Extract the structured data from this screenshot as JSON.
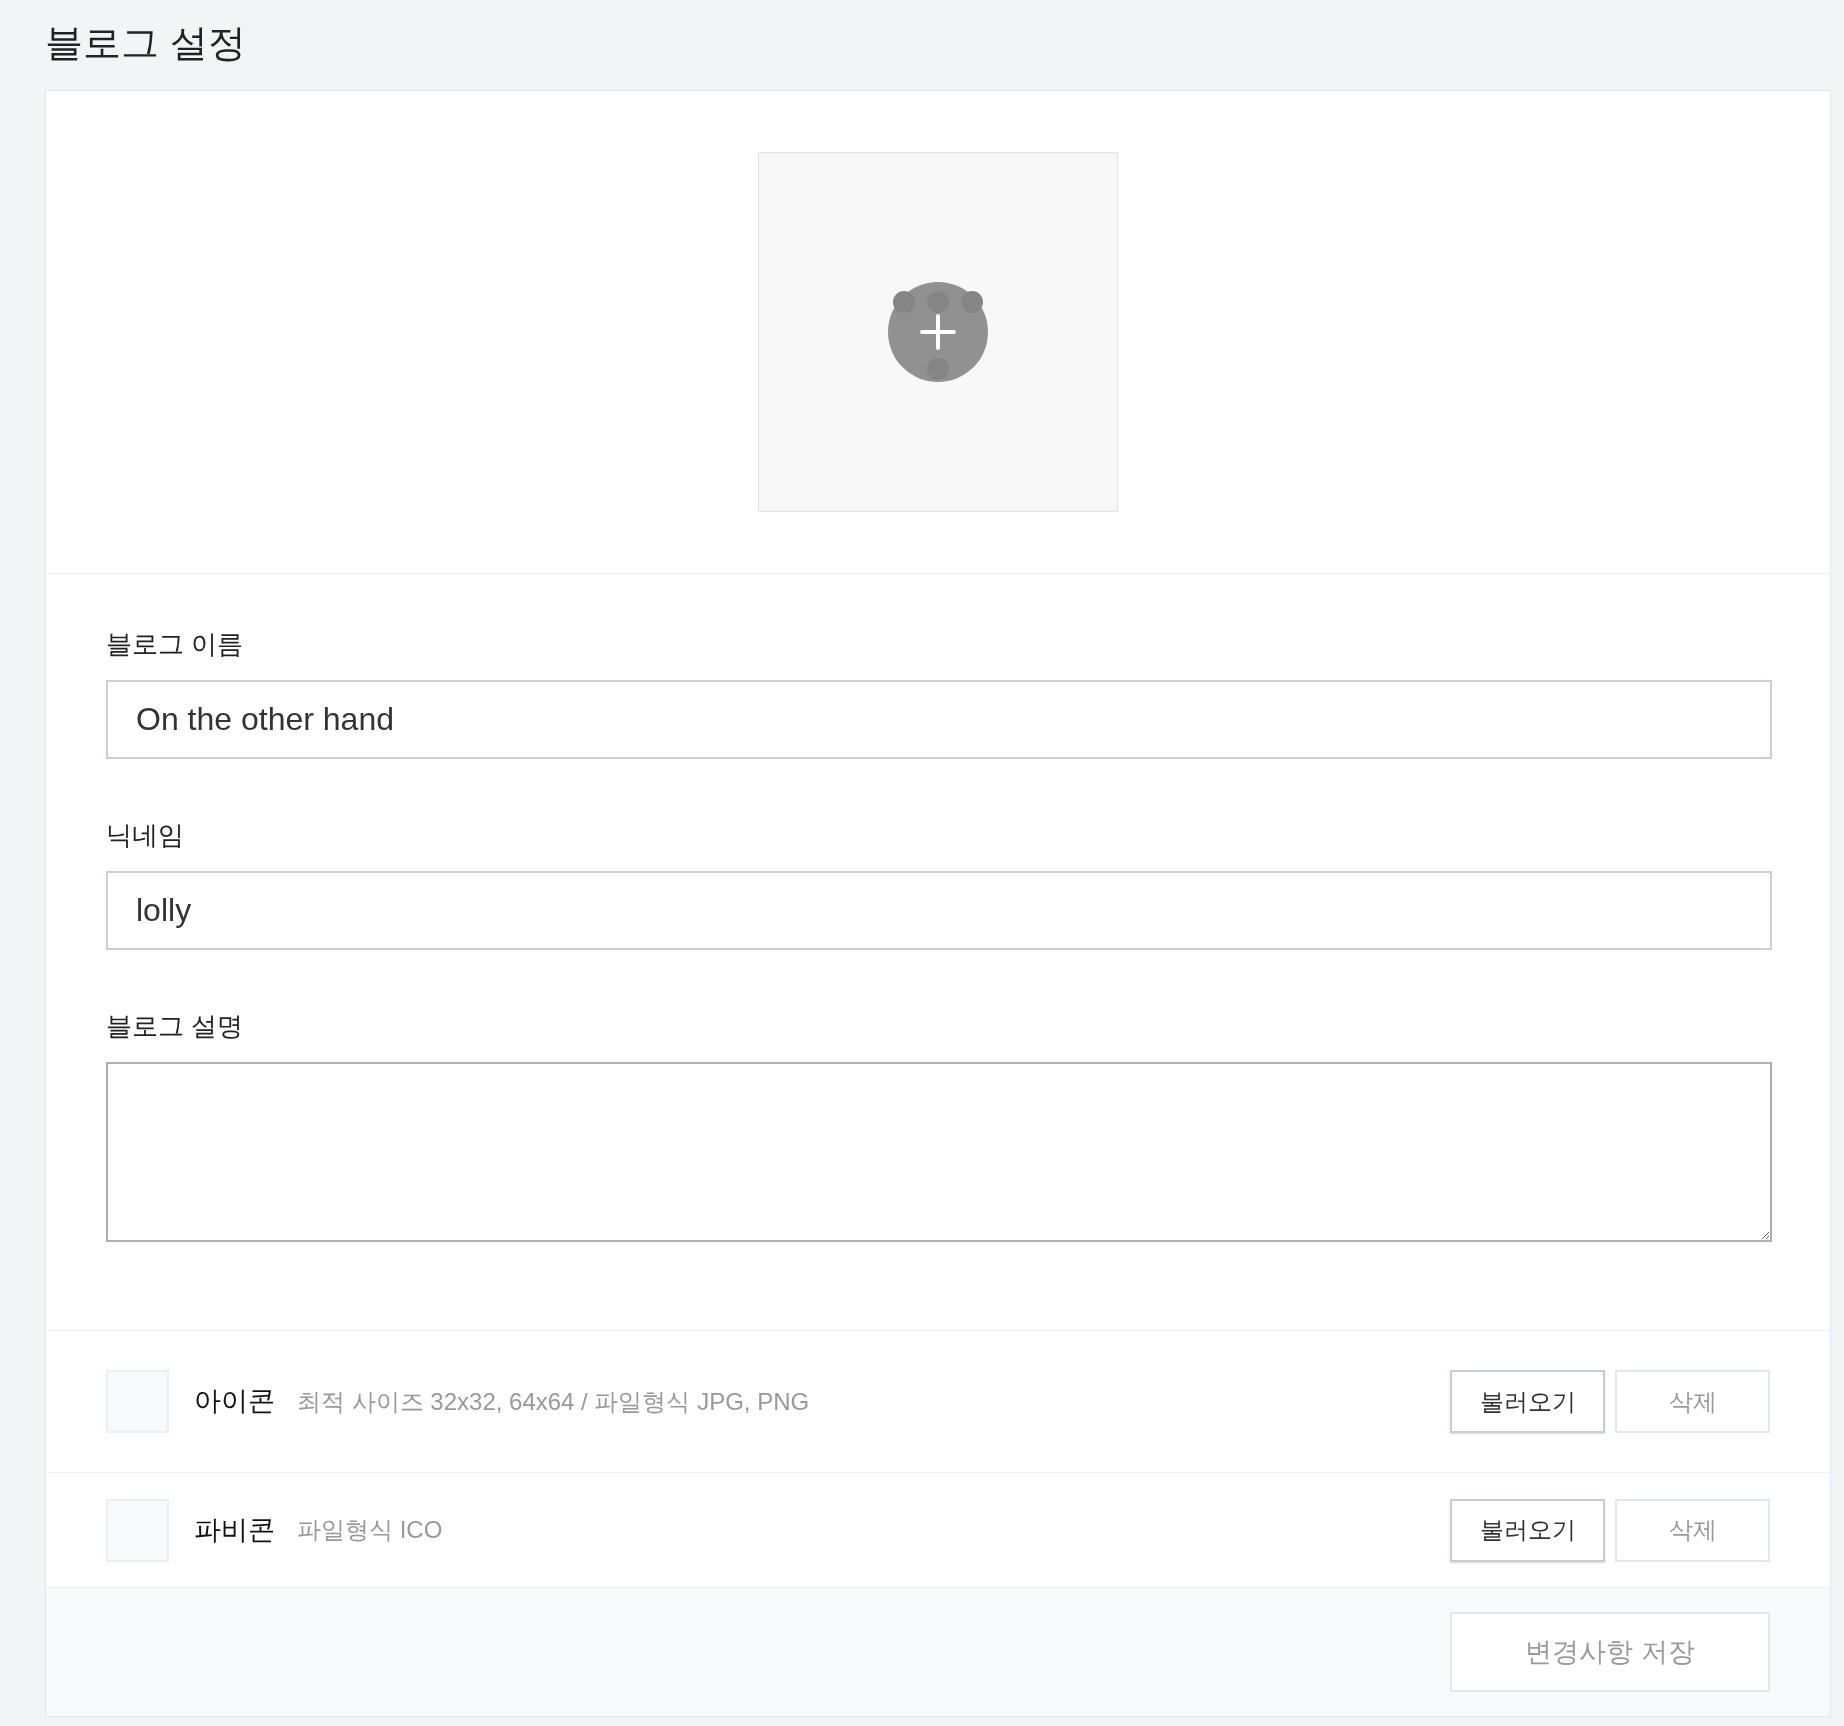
{
  "page": {
    "title": "블로그 설정"
  },
  "fields": [
    {
      "kind": "input",
      "label": "블로그 이름",
      "value": "On the other hand"
    },
    {
      "kind": "input",
      "label": "닉네임",
      "value": "lolly"
    },
    {
      "kind": "textarea",
      "label": "블로그 설명"
    }
  ],
  "image_rows": [
    {
      "label": "아이콘",
      "hint": "최적 사이즈 32x32, 64x64 / 파일형식 JPG, PNG",
      "load_button": {
        "label": "불러오기",
        "disabled": false
      },
      "delete_button": {
        "label": "삭제",
        "disabled": true
      }
    },
    {
      "label": "파비콘",
      "hint": "파일형식 ICO",
      "load_button": {
        "label": "불러오기",
        "disabled": false
      },
      "delete_button": {
        "label": "삭제",
        "disabled": true
      }
    }
  ],
  "save_button": {
    "label": "변경사항 저장",
    "disabled": true
  }
}
